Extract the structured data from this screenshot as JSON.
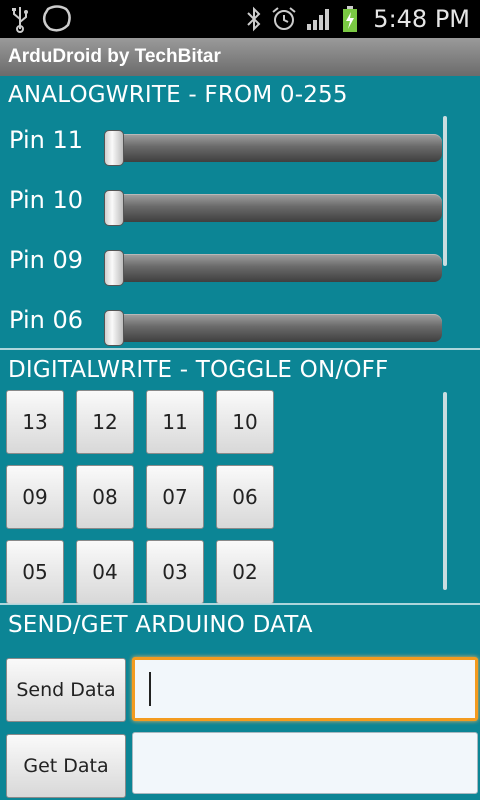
{
  "status_bar": {
    "time": "5:48 PM",
    "icons": [
      "usb-icon",
      "notification-blob-icon",
      "bluetooth-icon",
      "alarm-icon",
      "signal-icon",
      "battery-charging-icon"
    ]
  },
  "app": {
    "title": "ArduDroid by TechBitar"
  },
  "analog": {
    "title": "ANALOGWRITE - FROM 0-255",
    "range": [
      0,
      255
    ],
    "sliders": [
      {
        "label": "Pin 11",
        "value": 0
      },
      {
        "label": "Pin 10",
        "value": 0
      },
      {
        "label": "Pin 09",
        "value": 0
      },
      {
        "label": "Pin 06",
        "value": 0
      }
    ]
  },
  "digital": {
    "title": "DIGITALWRITE - TOGGLE ON/OFF",
    "buttons": [
      "13",
      "12",
      "11",
      "10",
      "09",
      "08",
      "07",
      "06",
      "05",
      "04",
      "03",
      "02"
    ]
  },
  "data": {
    "title": "SEND/GET ARDUINO DATA",
    "send_label": "Send Data",
    "get_label": "Get Data",
    "send_value": "",
    "get_value": ""
  },
  "colors": {
    "background": "#0c8595",
    "focus": "#f39b1f"
  }
}
